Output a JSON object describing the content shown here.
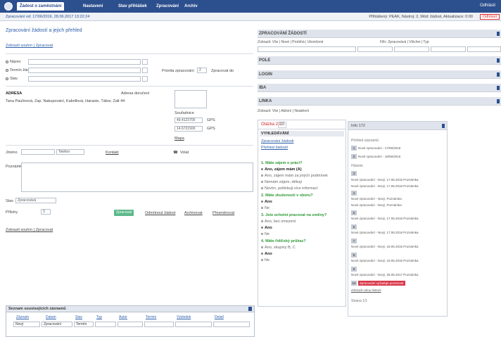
{
  "topbar": {
    "tabs": [
      "Žádost o zaměstnání",
      "Nastavení",
      "Stav přihlášek",
      "Zpracování",
      "Archiv"
    ],
    "right": "Odhlásit"
  },
  "infobar": {
    "left": "Zpracování od: 17/06/2016, 28.06.2017 13:22:24",
    "right": "Přihlášený: PEAK, Nástroj: 2, Mód: žádost, Aktualizace: 0:00",
    "logout": "Odhlásit"
  },
  "left": {
    "title": "Zpracování žádostí a jejich přehled",
    "subtitle": "Zobrazit souhrn | Zpracovat",
    "rows": [
      "Název",
      "Termín žádosti / zpracování",
      "Stav"
    ],
    "row_values": [
      "",
      "",
      ""
    ],
    "priority_label": "Priorita zpracování",
    "priority_value": "2",
    "deadline_label": "Zpracovat do",
    "address_label": "ADRESA",
    "address_value": "Tana Paulínová, Zap. Nakupování, Kabrillová, Haraste, Tábor, Zalt 44",
    "address_box_label": "Adresa doručení",
    "coords_label": "Souřadnice",
    "coord_1": "49.4123700",
    "coord_1_unit": "GPS",
    "coord_2": "14.6721500",
    "coord_2_unit": "GPS",
    "map_link": "Mapa",
    "name_label": "Jméno",
    "name_value": "",
    "phone_value": "Telefon",
    "contact_link": "Kontakt",
    "call_btn": "Volat",
    "note_label": "Poznámka",
    "note_value": "",
    "state_label": "Stav",
    "state_value": "Zpracovává",
    "attachments_label": "Přílohy",
    "attachments_value": "3",
    "green_btn": "Zpracovat",
    "links": [
      "Odmítnout žádost",
      "Archivovat",
      "Přesměrovat"
    ],
    "left_link": "Zobrazit souhrn | Zpracovat",
    "bottom_title": "Seznam souvisejících záznamů",
    "bottom_cols": [
      "Záznam",
      "Datum",
      "Stav",
      "Typ",
      "Autor",
      "Termín",
      "Výsledek",
      "Detail"
    ],
    "bottom_values": [
      "Nový",
      "Zpracování",
      "Termín",
      "",
      "",
      "",
      "",
      ""
    ]
  },
  "right": {
    "search_head": "ZPRACOVÁNÍ ŽÁDOSTÍ",
    "filter_left": "Zobrazit: Vše | Nové | Probíhá | Ukončené",
    "filter_right": "Filtr: Zpracovává | Všichni | Typ",
    "sections": [
      "POLE",
      "LOGIN",
      "IBA",
      "LINKA"
    ],
    "linka_sub": "Zobrazit: Vše | Aktivní | Neaktivní",
    "q_tab": "Otázka 20",
    "q_tab2": "10",
    "q_head": "VYHLEDÁVÁNÍ",
    "q_links": [
      "Zpracování žádosti",
      "Přehled žádostí"
    ],
    "q1": "1. Máte zájem o práci?",
    "q1_opts": [
      "Ano, zájem mám (A)",
      "Ano, zájem mám za jiných podmínek",
      "Nemám zájem, děkuji",
      "Nevím, potřebuji více informací"
    ],
    "q2": "2. Máte zkušenosti v oboru?",
    "q2_opts": [
      "Ano",
      "Ne"
    ],
    "q3": "3. Jste ochotni pracovat na směny?",
    "q3_opts": [
      "Ano, bez omezení",
      "Ano",
      "Ne"
    ],
    "q4": "4. Máte řidičský průkaz?",
    "q4_opts": [
      "Ano, skupiny B, C",
      "Ano",
      "Ne"
    ],
    "side_head": "Info 172",
    "side_label1": "Přehled záznamů",
    "side_label2": "Historie",
    "side_items": [
      "Nové zpracování - 17/06/2016",
      "Nové zpracování - 18/06/2016",
      "Nové zpracování - Nový, 17.06.2016 Poznámka",
      "Nové zpracování - Nový, 17.06.2016 Poznámka",
      "Nové zpracování - Nový, Poznámka",
      "Nové zpracování - Nový, Poznámka",
      "Nové zpracování - Nový, 17.06.2016 Poznámka",
      "Nové zpracování - Nový, 17.06.2016 Poznámka",
      "Nové zpracování - Nový, 18.06.2016 Poznámka",
      "Nové zpracování - Nový, 18.06.2016 Poznámka",
      "Nové zpracování - Nový, 28.06.2017 Poznámka"
    ],
    "side_red": "Zpracování vyžaduje pozornost",
    "side_foot_link": "Zobrazit celou historii",
    "side_foot": "Strana 1/1"
  }
}
